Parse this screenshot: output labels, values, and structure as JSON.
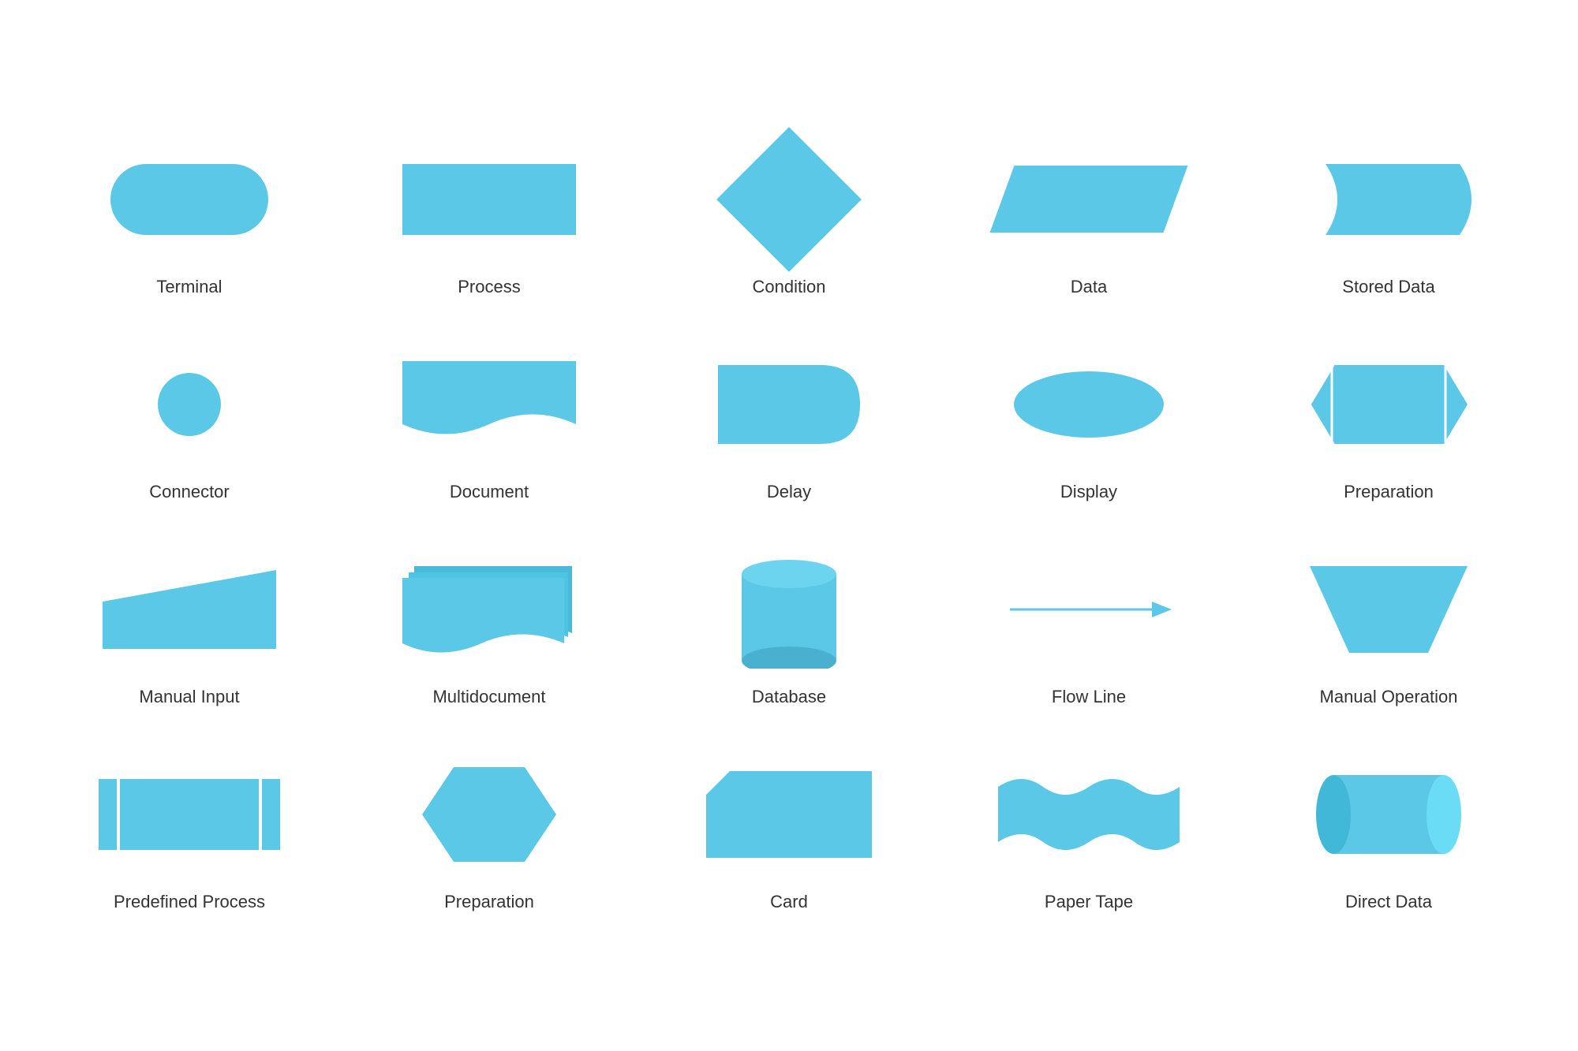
{
  "shapes": [
    {
      "id": "terminal",
      "label": "Terminal"
    },
    {
      "id": "process",
      "label": "Process"
    },
    {
      "id": "condition",
      "label": "Condition"
    },
    {
      "id": "data",
      "label": "Data"
    },
    {
      "id": "stored-data",
      "label": "Stored Data"
    },
    {
      "id": "connector",
      "label": "Connector"
    },
    {
      "id": "document",
      "label": "Document"
    },
    {
      "id": "delay",
      "label": "Delay"
    },
    {
      "id": "display",
      "label": "Display"
    },
    {
      "id": "preparation",
      "label": "Preparation"
    },
    {
      "id": "manual-input",
      "label": "Manual Input"
    },
    {
      "id": "multidocument",
      "label": "Multidocument"
    },
    {
      "id": "database",
      "label": "Database"
    },
    {
      "id": "flow-line",
      "label": "Flow Line"
    },
    {
      "id": "manual-operation",
      "label": "Manual Operation"
    },
    {
      "id": "predefined-process",
      "label": "Predefined Process"
    },
    {
      "id": "preparation2",
      "label": "Preparation"
    },
    {
      "id": "card",
      "label": "Card"
    },
    {
      "id": "paper-tape",
      "label": "Paper Tape"
    },
    {
      "id": "direct-data",
      "label": "Direct Data"
    }
  ],
  "color": "#5bc8e8"
}
